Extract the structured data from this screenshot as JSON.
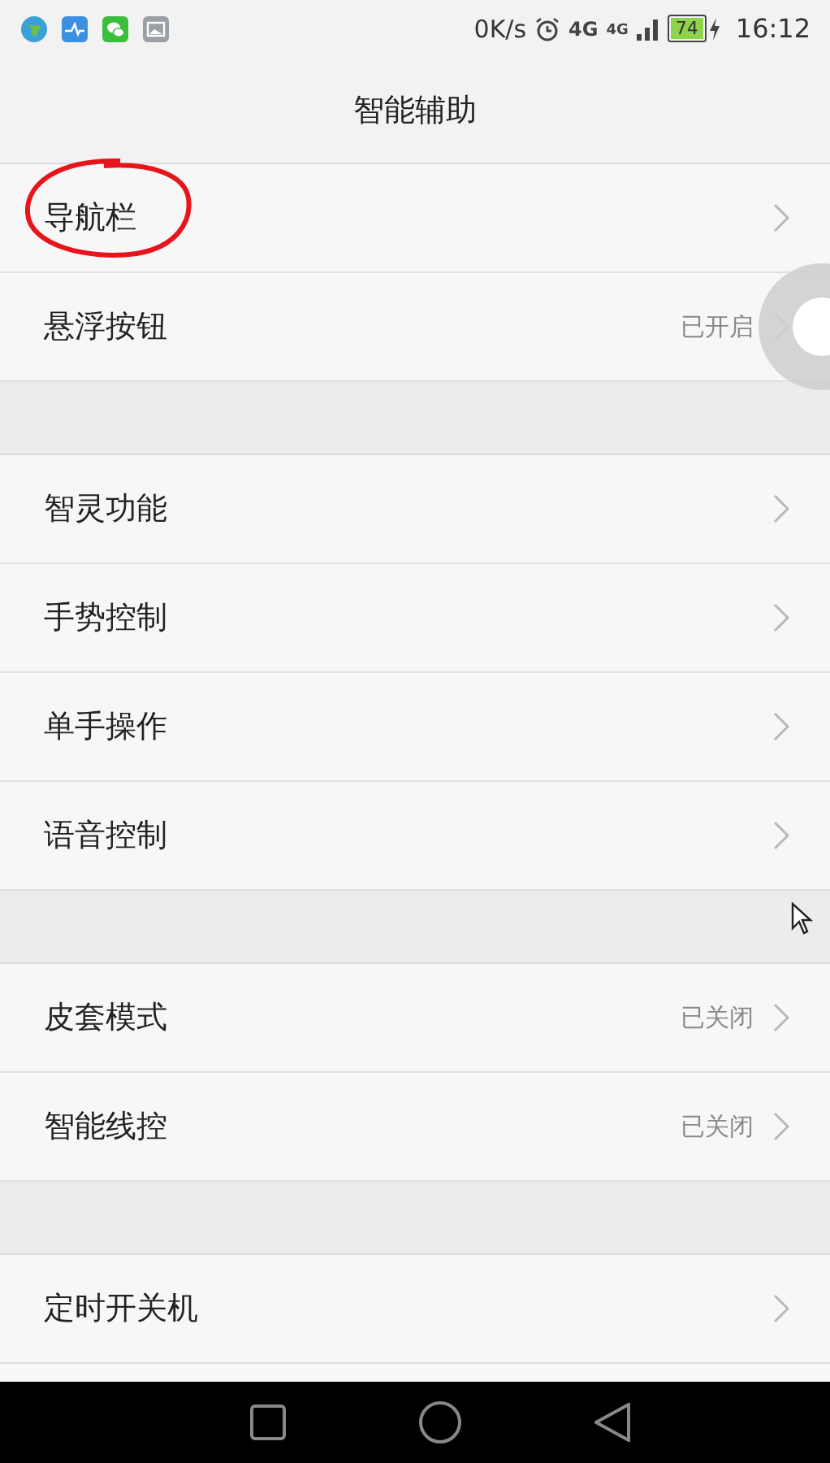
{
  "status_bar": {
    "speed": "0K/s",
    "network": "4G",
    "network_2": "4G",
    "battery": "74",
    "time": "16:12"
  },
  "title": "智能辅助",
  "groups": [
    [
      {
        "label": "导航栏",
        "annotated": true
      },
      {
        "label": "悬浮按钮",
        "status": "已开启",
        "annotated": false
      }
    ],
    [
      {
        "label": "智灵功能",
        "annotated": false
      },
      {
        "label": "手势控制",
        "annotated": false
      },
      {
        "label": "单手操作",
        "annotated": false
      },
      {
        "label": "语音控制",
        "annotated": false
      }
    ],
    [
      {
        "label": "皮套模式",
        "status": "已关闭",
        "annotated": false
      },
      {
        "label": "智能线控",
        "status": "已关闭",
        "annotated": false
      }
    ],
    [
      {
        "label": "定时开关机",
        "annotated": false
      }
    ]
  ]
}
